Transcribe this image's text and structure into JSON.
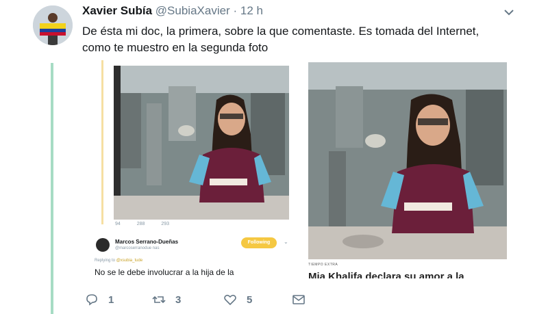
{
  "tweet": {
    "display_name": "Xavier Subía",
    "handle": "@SubiaXavier",
    "separator": "·",
    "time": "12 h",
    "text_line1": "De ésta mi doc, la primera, sobre la que comentaste. Es tomada del Internet,",
    "text_line2": "como te muestro en la segunda foto",
    "reply_count": "1",
    "retweet_count": "3",
    "like_count": "5",
    "icons": {
      "reply": "reply-icon",
      "retweet": "retweet-icon",
      "like": "heart-icon",
      "dm": "envelope-icon",
      "menu": "chevron-down-icon"
    }
  },
  "embedded_left": {
    "reply_count": "94",
    "retweet_count": "288",
    "like_count": "293",
    "name": "Marcos Serrano-Dueñas",
    "handle": "@marcoserranodue nas",
    "follow_label": "Following",
    "replying_prefix": "Replying to",
    "replying_to": "@xsubia_tude",
    "text": "No se le debe involucrar a la hija de la"
  },
  "embedded_right": {
    "label": "TIEMPO EXTRA",
    "headline": "Mia Khalifa declara su amor a la"
  },
  "colors": {
    "thread_line": "#a6dcc4",
    "follow_button": "#f5c842",
    "muted_text": "#657786"
  }
}
